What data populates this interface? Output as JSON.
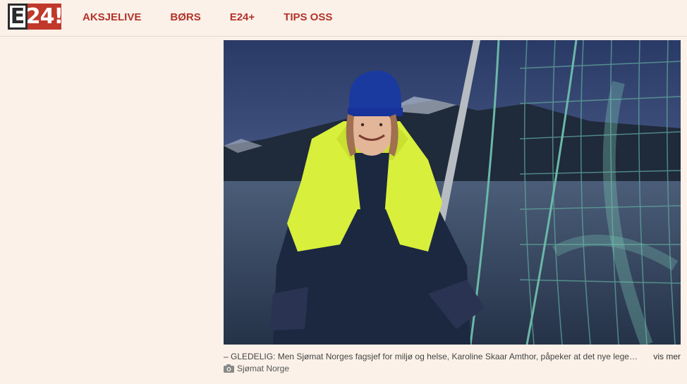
{
  "logo": {
    "e": "E",
    "num": "24",
    "bang": "!"
  },
  "nav": {
    "items": [
      {
        "label": "AKSJELIVE"
      },
      {
        "label": "BØRS"
      },
      {
        "label": "E24+"
      },
      {
        "label": "TIPS OSS"
      }
    ]
  },
  "article": {
    "image_alt": "Woman in a hi-vis yellow and navy flotation suit at a fish farm at dusk",
    "caption": "– GLEDELIG: Men Sjømat Norges fagsjef for miljø og helse, Karoline Skaar Amthor, påpeker at det nye legemi…",
    "vis_mer": "vis mer",
    "credit_icon": "camera-icon",
    "credit": "Sjømat Norge"
  },
  "colors": {
    "background": "#fbf1e8",
    "nav_text": "#b3332b",
    "logo_red": "#c0392b"
  }
}
